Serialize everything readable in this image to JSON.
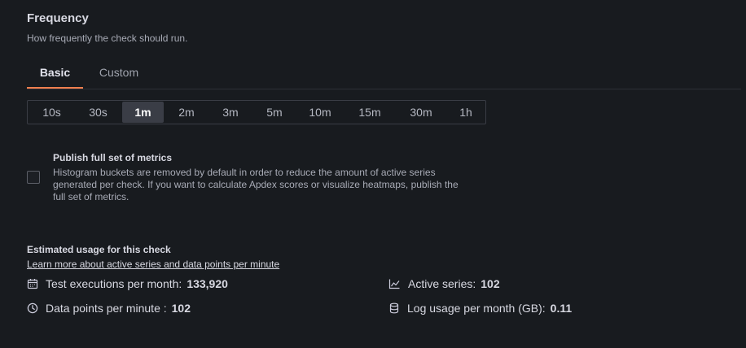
{
  "frequency": {
    "title": "Frequency",
    "description": "How frequently the check should run.",
    "tabs": [
      {
        "label": "Basic",
        "active": true
      },
      {
        "label": "Custom",
        "active": false
      }
    ],
    "options": [
      "10s",
      "30s",
      "1m",
      "2m",
      "3m",
      "5m",
      "10m",
      "15m",
      "30m",
      "1h"
    ],
    "selected": "1m"
  },
  "metrics": {
    "checked": false,
    "label": "Publish full set of metrics",
    "description": "Histogram buckets are removed by default in order to reduce the amount of active series generated per check. If you want to calculate Apdex scores or visualize heatmaps, publish the full set of metrics."
  },
  "usage": {
    "title": "Estimated usage for this check",
    "link": "Learn more about active series and data points per minute",
    "stats": {
      "executions": {
        "label": "Test executions per month:",
        "value": "133,920",
        "icon": "calendar-icon"
      },
      "active_series": {
        "label": "Active series:",
        "value": "102",
        "icon": "chart-line-icon"
      },
      "datapoints": {
        "label": "Data points per minute :",
        "value": "102",
        "icon": "clock-icon"
      },
      "log_usage": {
        "label": "Log usage per month (GB):",
        "value": "0.11",
        "icon": "database-icon"
      }
    }
  },
  "colors": {
    "background": "#181b1f",
    "accent": "#f07f4e",
    "selected_option": "#3a3d46"
  }
}
